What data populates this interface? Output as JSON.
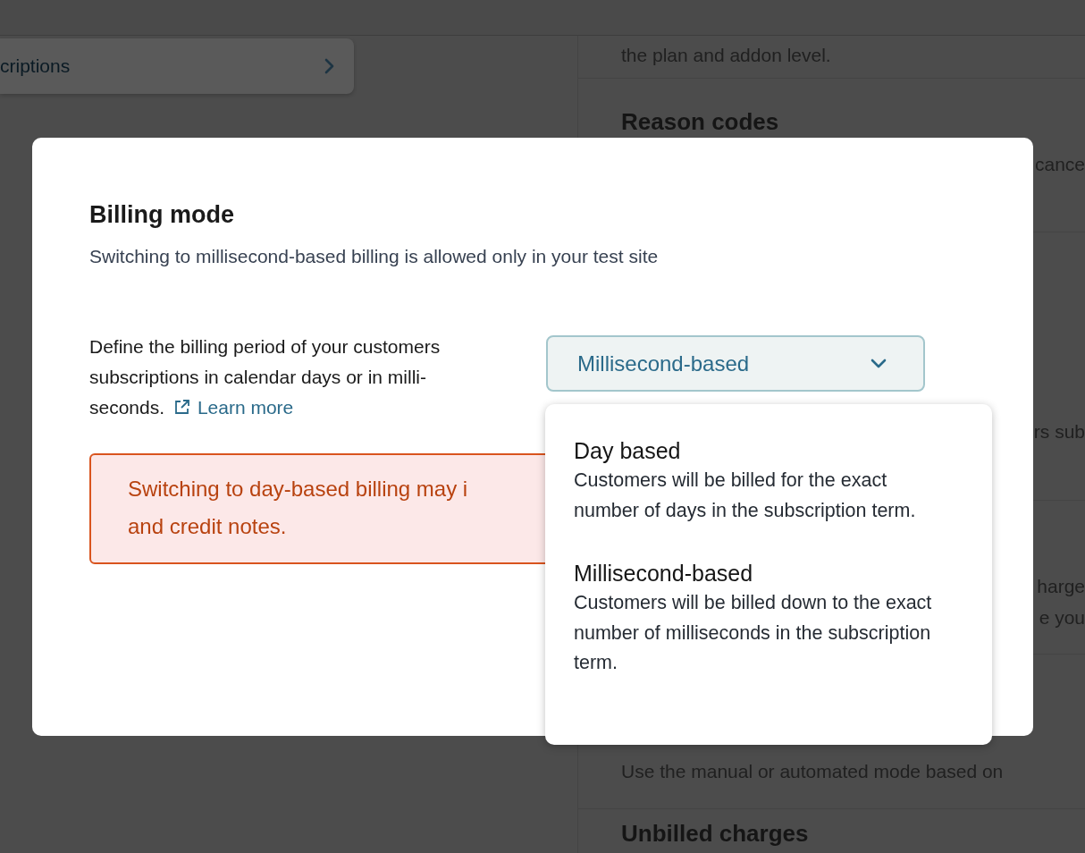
{
  "background": {
    "list_card": {
      "label": "criptions"
    },
    "sections": [
      {
        "lines": [
          {
            "kind": "full",
            "text": "the plan and addon level."
          }
        ]
      },
      {
        "heading": "Reason codes",
        "lines": [
          {
            "kind": "clipped",
            "text": "cance"
          }
        ]
      },
      {
        "lines": [
          {
            "kind": "clipped",
            "text": "rs sub"
          }
        ]
      },
      {
        "lines": [
          {
            "kind": "clipped",
            "text": "harge"
          },
          {
            "kind": "clipped",
            "text": "e you"
          }
        ]
      },
      {
        "lines": [
          {
            "kind": "full",
            "text": "Use the manual or automated mode based on"
          }
        ]
      },
      {
        "heading": "Unbilled charges"
      }
    ]
  },
  "modal": {
    "title": "Billing mode",
    "subtitle": "Switching to millisecond-based billing is allowed only in your test site",
    "description": "Define the billing period of your customers subscriptions in calendar days or in milli-seconds.",
    "link": "Learn more",
    "select": {
      "value": "Millisecond-based",
      "expanded": true
    },
    "alert": {
      "lines": [
        "Switching to day-based billing may i",
        "and credit notes."
      ]
    }
  },
  "menu": {
    "options": [
      {
        "title": "Day based",
        "description": "Customers will be billed for the exact number of days in the subscription term."
      },
      {
        "title": "Millisecond-based",
        "description": "Customers will be billed down to the exact number of milliseconds in the subscription term."
      }
    ]
  }
}
